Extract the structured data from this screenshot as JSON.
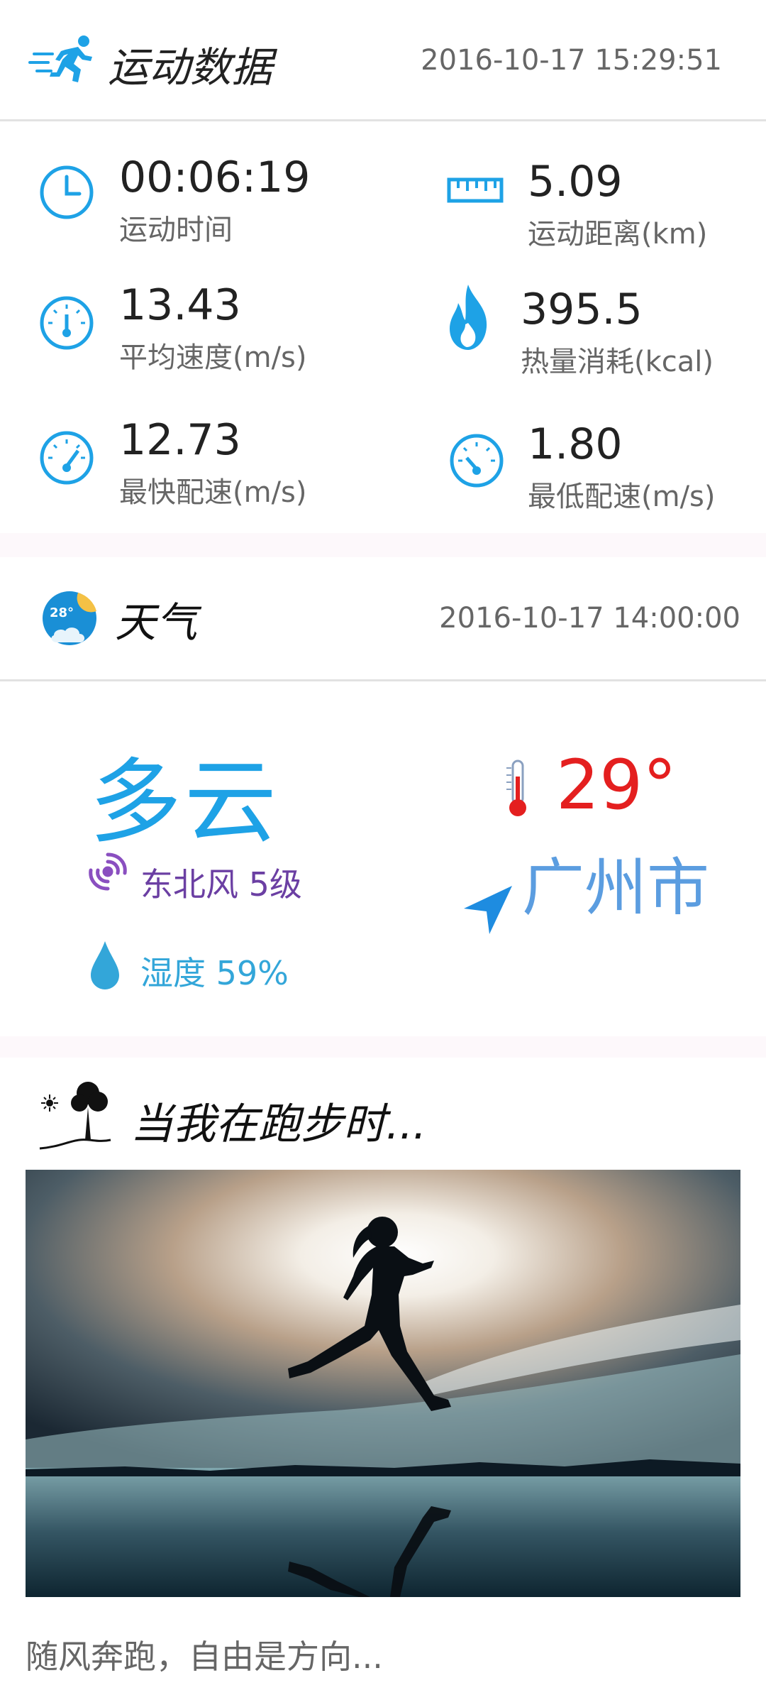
{
  "sport": {
    "title": "运动数据",
    "time": "2016-10-17 15:29:51",
    "stats": [
      {
        "value": "00:06:19",
        "label": "运动时间",
        "icon": "clock-icon"
      },
      {
        "value": "5.09",
        "label": "运动距离(km)",
        "icon": "ruler-icon"
      },
      {
        "value": "13.43",
        "label": "平均速度(m/s)",
        "icon": "gauge-icon"
      },
      {
        "value": "395.5",
        "label": "热量消耗(kcal)",
        "icon": "flame-icon"
      },
      {
        "value": "12.73",
        "label": "最快配速(m/s)",
        "icon": "speedometer-icon"
      },
      {
        "value": "1.80",
        "label": "最低配速(m/s)",
        "icon": "speedometer-icon"
      }
    ]
  },
  "weather": {
    "title": "天气",
    "badge_temp": "28°",
    "time": "2016-10-17 14:00:00",
    "condition": "多云",
    "temperature": "29°",
    "wind": "东北风 5级",
    "humidity": "湿度 59%",
    "city": "广州市"
  },
  "running": {
    "title": "当我在跑步时...",
    "caption": "随风奔跑，自由是方向..."
  },
  "colors": {
    "accent": "#1ea2e6",
    "temperature": "#e41f1f",
    "wind": "#6b3fa3",
    "humidity": "#33a6d9",
    "city": "#5b9de0"
  }
}
